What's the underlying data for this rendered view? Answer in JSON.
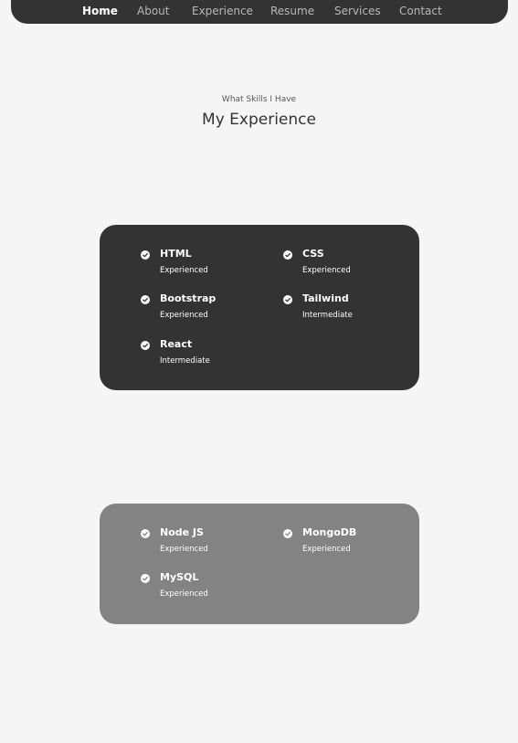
{
  "nav": {
    "items": [
      {
        "label": "Home",
        "active": true
      },
      {
        "label": "About"
      },
      {
        "label": "Experience"
      },
      {
        "label": "Resume"
      },
      {
        "label": "Services"
      },
      {
        "label": "Contact"
      }
    ]
  },
  "header": {
    "subtitle": "What Skills I Have",
    "title": "My Experience"
  },
  "cards": [
    {
      "theme": "dark",
      "color": "#333333",
      "skills": [
        {
          "name": "HTML",
          "level": "Experienced"
        },
        {
          "name": "CSS",
          "level": "Experienced"
        },
        {
          "name": "Bootstrap",
          "level": "Experienced"
        },
        {
          "name": "Tailwind",
          "level": "Intermediate"
        },
        {
          "name": "React",
          "level": "Intermediate"
        }
      ]
    },
    {
      "theme": "gray",
      "color": "#838383",
      "skills": [
        {
          "name": "Node JS",
          "level": "Experienced"
        },
        {
          "name": "MongoDB",
          "level": "Experienced"
        },
        {
          "name": "MySQL",
          "level": "Experienced"
        }
      ]
    }
  ],
  "icons": {
    "skill": "check-circle-icon"
  }
}
